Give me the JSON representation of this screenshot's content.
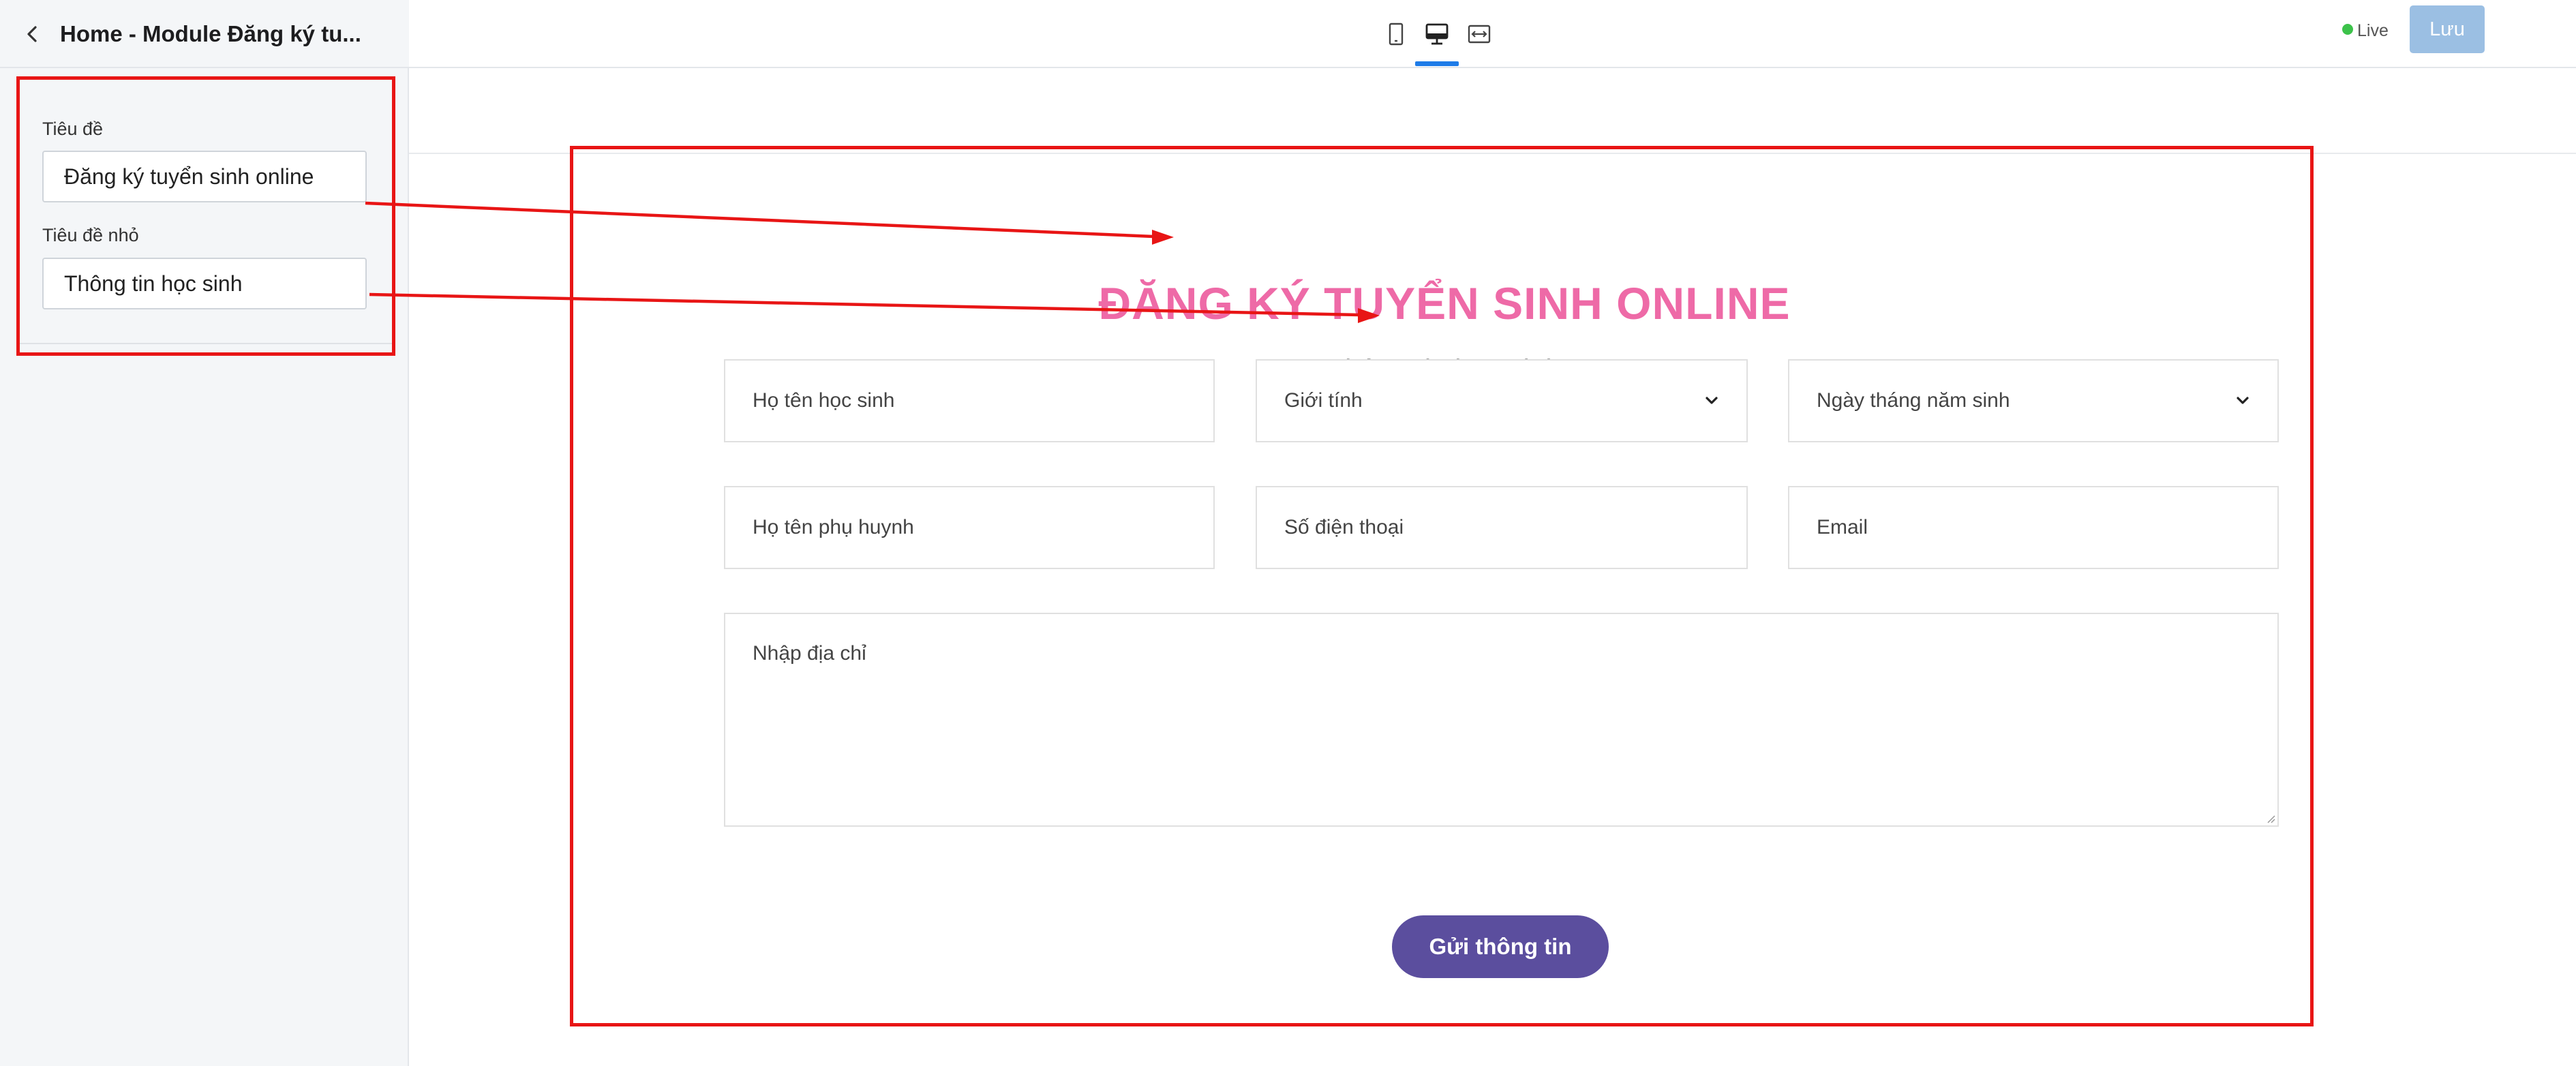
{
  "sidebar": {
    "title": "Home - Module Đăng ký tu...",
    "fields": [
      {
        "label": "Tiêu đề",
        "value": "Đăng ký tuyển sinh online"
      },
      {
        "label": "Tiêu đề nhỏ",
        "value": "Thông tin học sinh"
      }
    ]
  },
  "toolbar": {
    "devices": [
      "mobile-icon",
      "desktop-icon",
      "fullwidth-icon"
    ],
    "active_device": "desktop-icon",
    "live_label": "Live",
    "save_label": "Lưu",
    "colors": {
      "accent": "#1e7ce8",
      "live": "#3cc24a",
      "save": "#9bbfe3"
    }
  },
  "form": {
    "title": "ĐĂNG KÝ TUYỂN SINH ONLINE",
    "subtitle": "Thông tin học sinh",
    "fields": {
      "student_name": "Họ tên học sinh",
      "gender": "Giới tính",
      "birthdate": "Ngày tháng năm sinh",
      "parent_name": "Họ tên phụ huynh",
      "phone": "Số điện thoại",
      "email": "Email",
      "address": "Nhập địa chỉ"
    },
    "submit_label": "Gửi thông tin",
    "colors": {
      "title": "#ee6aa7",
      "submit": "#5b4e9e",
      "annotation": "#e81515"
    }
  }
}
